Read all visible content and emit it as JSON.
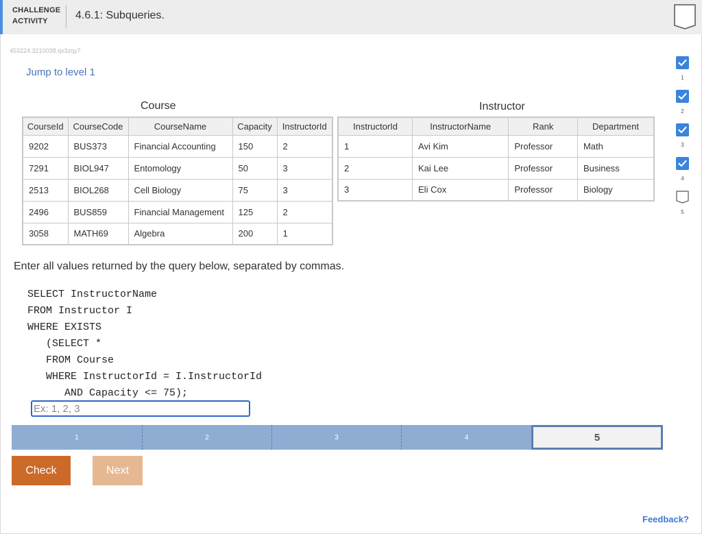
{
  "header": {
    "label_line1": "CHALLENGE",
    "label_line2": "ACTIVITY",
    "title": "4.6.1: Subqueries."
  },
  "activity_id": "453224.3210038.qx3zqy7",
  "jump_link": "Jump to level 1",
  "course_table": {
    "caption": "Course",
    "headers": [
      "CourseId",
      "CourseCode",
      "CourseName",
      "Capacity",
      "InstructorId"
    ],
    "rows": [
      [
        "9202",
        "BUS373",
        "Financial Accounting",
        "150",
        "2"
      ],
      [
        "7291",
        "BIOL947",
        "Entomology",
        "50",
        "3"
      ],
      [
        "2513",
        "BIOL268",
        "Cell Biology",
        "75",
        "3"
      ],
      [
        "2496",
        "BUS859",
        "Financial Management",
        "125",
        "2"
      ],
      [
        "3058",
        "MATH69",
        "Algebra",
        "200",
        "1"
      ]
    ]
  },
  "instructor_table": {
    "caption": "Instructor",
    "headers": [
      "InstructorId",
      "InstructorName",
      "Rank",
      "Department"
    ],
    "rows": [
      [
        "1",
        "Avi Kim",
        "Professor",
        "Math"
      ],
      [
        "2",
        "Kai Lee",
        "Professor",
        "Business"
      ],
      [
        "3",
        "Eli Cox",
        "Professor",
        "Biology"
      ]
    ]
  },
  "prompt": "Enter all values returned by the query below, separated by commas.",
  "query_lines": [
    "SELECT InstructorName",
    "FROM Instructor I",
    "WHERE EXISTS",
    "   (SELECT *",
    "   FROM Course",
    "   WHERE InstructorId = I.InstructorId",
    "      AND Capacity <= 75);"
  ],
  "answer": {
    "value": "",
    "placeholder": "Ex: 1, 2, 3"
  },
  "progress": {
    "segments": [
      "1",
      "2",
      "3",
      "4",
      "5"
    ],
    "current": "5"
  },
  "buttons": {
    "check": "Check",
    "next": "Next"
  },
  "feedback": "Feedback?",
  "levels": [
    {
      "number": "1",
      "completed": true
    },
    {
      "number": "2",
      "completed": true
    },
    {
      "number": "3",
      "completed": true
    },
    {
      "number": "4",
      "completed": true
    },
    {
      "number": "5",
      "completed": false
    }
  ],
  "colors": {
    "accent_blue": "#4a90e2",
    "check_orange": "#cc6a29",
    "next_disabled": "#e6b892",
    "progress_done": "#8fadd3",
    "level_check": "#3a84dc"
  }
}
